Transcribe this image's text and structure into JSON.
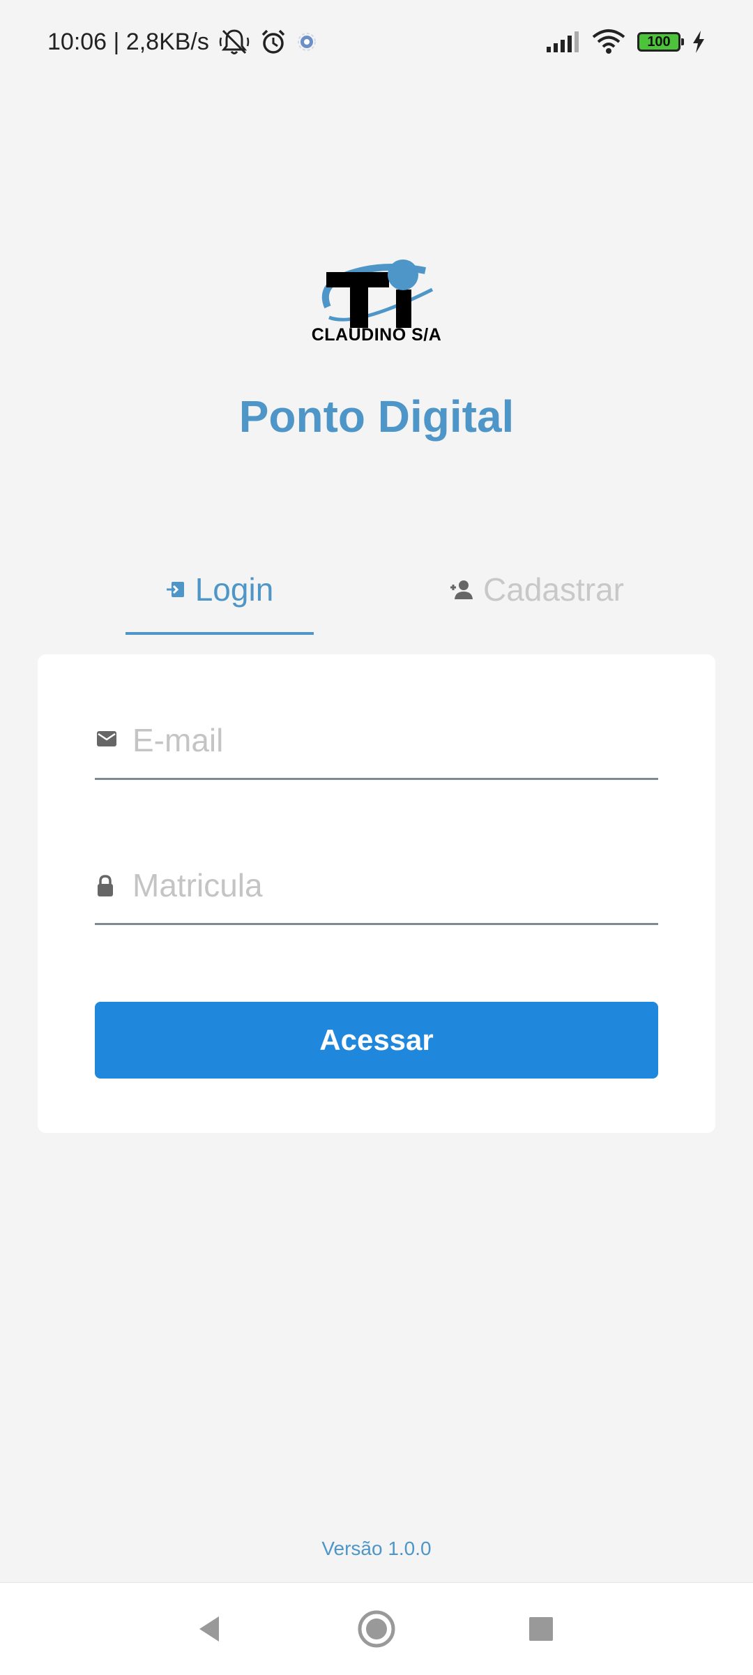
{
  "status_bar": {
    "time_speed": "10:06 | 2,8KB/s",
    "battery_level": "100",
    "icons": [
      "notifications-muted-icon",
      "alarm-icon",
      "settings-gear-icon",
      "signal-icon",
      "wifi-icon",
      "battery-icon",
      "charging-icon"
    ]
  },
  "logo": {
    "text": "CLAUDINO S/A",
    "mark": "Ti",
    "colors": {
      "black": "#000000",
      "blue": "#4e96c8"
    }
  },
  "app_title": "Ponto Digital",
  "tabs": [
    {
      "label": "Login",
      "icon": "login-icon",
      "active": true
    },
    {
      "label": "Cadastrar",
      "icon": "add-person-icon",
      "active": false
    }
  ],
  "form": {
    "email": {
      "placeholder": "E-mail",
      "value": "",
      "icon": "email-icon"
    },
    "matricula": {
      "placeholder": "Matricula",
      "value": "",
      "icon": "lock-icon"
    },
    "submit_label": "Acessar"
  },
  "version": "Versão 1.0.0",
  "colors": {
    "accent": "#4e96c8",
    "button": "#2088dc",
    "background": "#f4f4f4",
    "inactive_tab": "#c8c8c8"
  },
  "nav_bar": {
    "buttons": [
      "back-icon",
      "home-icon",
      "recents-icon"
    ]
  }
}
